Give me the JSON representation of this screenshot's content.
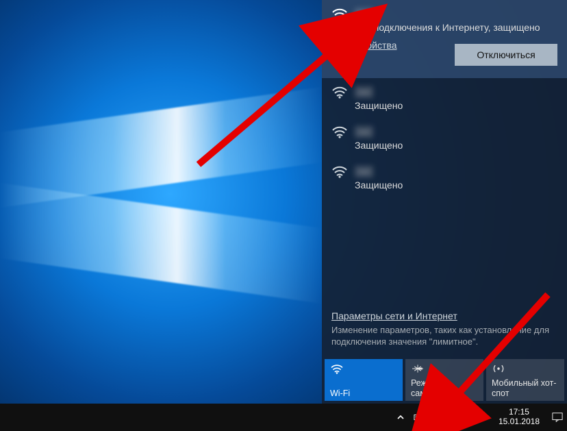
{
  "flyout": {
    "selected_network": {
      "ssid": "—",
      "status": "Нет подключения к Интернету, защищено",
      "properties_label": "Свойства",
      "disconnect_label": "Отключиться"
    },
    "networks": [
      {
        "ssid": "—",
        "status": "Защищено"
      },
      {
        "ssid": "—",
        "status": "Защищено"
      },
      {
        "ssid": "—",
        "status": "Защищено"
      }
    ],
    "settings": {
      "title": "Параметры сети и Интернет",
      "desc": "Изменение параметров, таких как установление для подключения значения \"лимитное\"."
    },
    "tiles": {
      "wifi": "Wi-Fi",
      "airplane": "Режим \"в самолете\"",
      "hotspot": "Мобильный хот-спот"
    }
  },
  "taskbar": {
    "lang": "РУС",
    "time": "17:15",
    "date": "15.01.2018"
  }
}
